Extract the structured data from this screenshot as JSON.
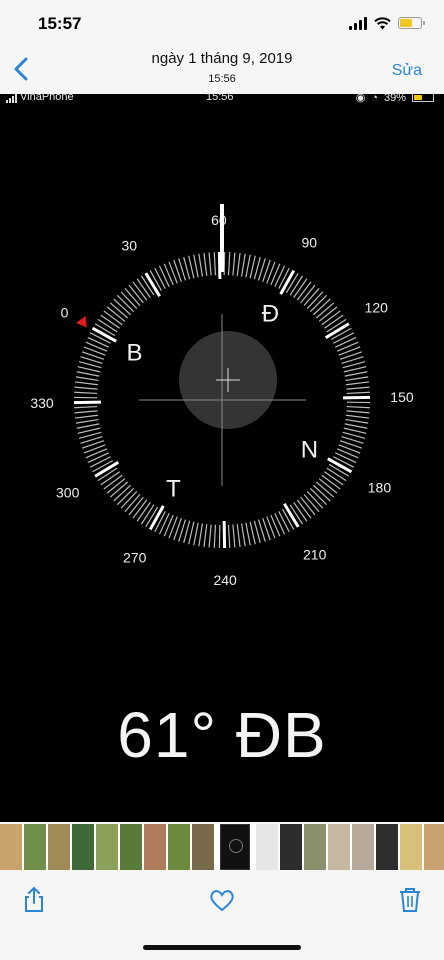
{
  "status_bar": {
    "time": "15:57"
  },
  "nav": {
    "date": "ngày 1 tháng 9, 2019",
    "time": "15:56",
    "edit_label": "Sửa"
  },
  "photo": {
    "inner_status": {
      "carrier": "VinaPhone",
      "time": "15:56",
      "battery": "39%"
    },
    "compass": {
      "heading_deg": 61,
      "direction_marker_deg": 0,
      "degree_labels": [
        "0",
        "30",
        "60",
        "90",
        "120",
        "150",
        "180",
        "210",
        "240",
        "270",
        "300",
        "330"
      ],
      "cardinals": {
        "north": "B",
        "east": "Đ",
        "south": "N",
        "west": "T"
      },
      "marker_color": "#e01b1b"
    },
    "heading_text": "61° ĐB"
  },
  "thumbnails": {
    "colors": [
      "#c9a36b",
      "#6f8f4a",
      "#a08a56",
      "#3f6a38",
      "#8da05a",
      "#5a7a3a",
      "#b07b5a",
      "#6c8a3d",
      "#7a6a4c",
      "#e6e6e6",
      "#2d2d2d",
      "#8a8f6c",
      "#c4b8a2",
      "#b7a99a",
      "#2f2f2f",
      "#d9c07a",
      "#caa26f",
      "#a74b3a",
      "#d8d6cf",
      "#d7a26b",
      "#bcae8c",
      "#c9a15a",
      "#b89c6f",
      "#d2c7a8",
      "#a18d6a",
      "#c5a071",
      "#8a8a5c",
      "#cfc2a0"
    ]
  },
  "toolbar": {
    "share_icon": "share-icon",
    "favorite_icon": "heart-icon",
    "delete_icon": "trash-icon",
    "accent": "#2a86d6"
  }
}
